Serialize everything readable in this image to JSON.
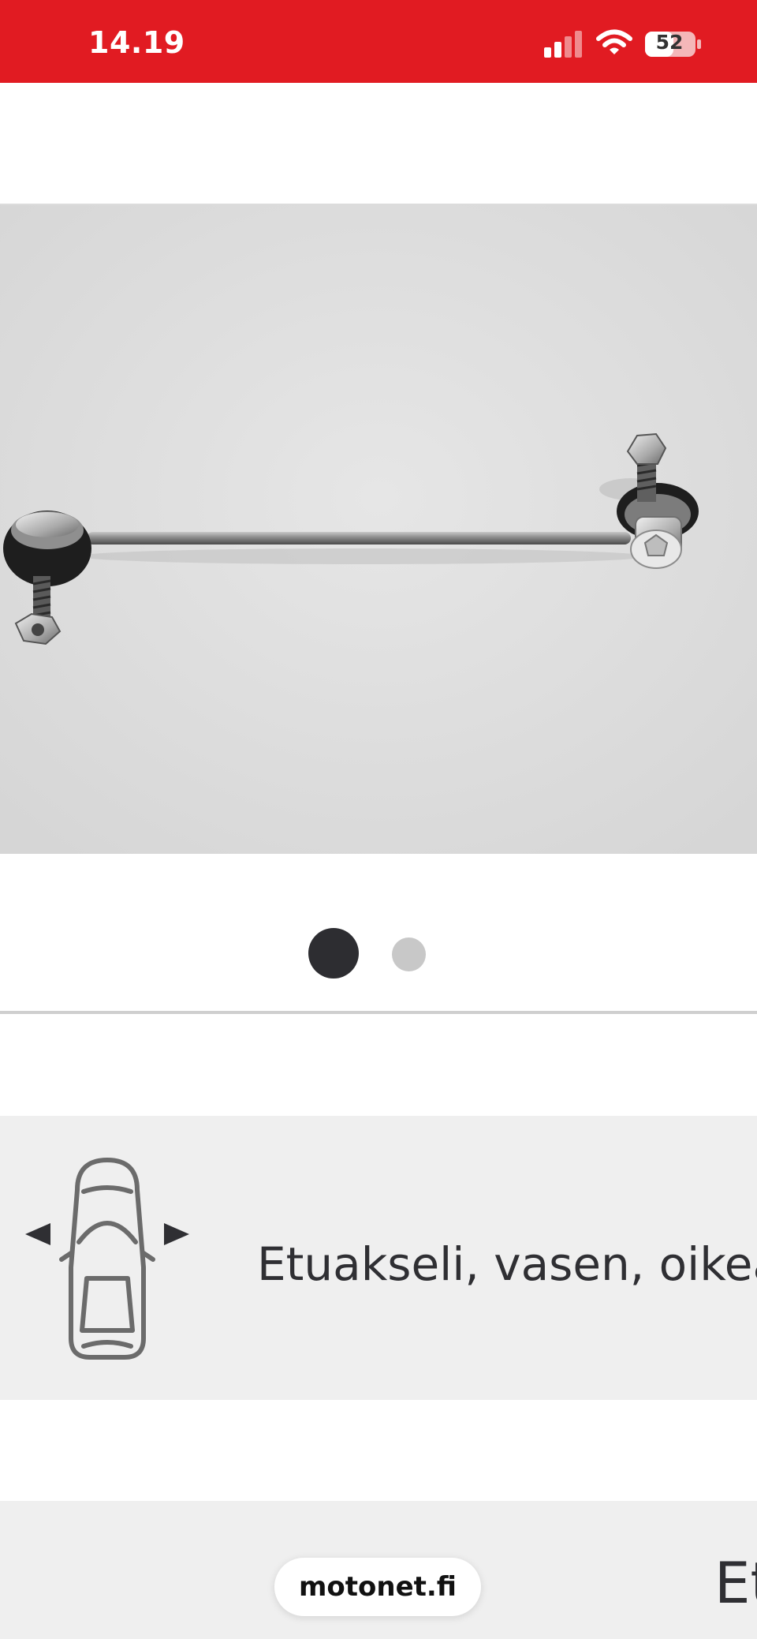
{
  "status_bar": {
    "time": "14.19",
    "battery": "52",
    "icons": [
      "signal-icon",
      "wifi-icon",
      "battery-icon"
    ],
    "color": "#e11b22"
  },
  "product_image": {
    "description_icon": "stabilizer-link-rod",
    "slide_count": 2,
    "active_slide": 1
  },
  "fitment": {
    "position_text": "Etuakseli, vasen, oikea",
    "icon": "car-front-axle-icon"
  },
  "bottom": {
    "clipped_text": "Et",
    "url": "motonet.fi"
  },
  "colors": {
    "brand_red": "#e11b22",
    "dot_active": "#2d2d31",
    "dot_inactive": "#c8c8c8",
    "panel_bg": "#efefef"
  }
}
